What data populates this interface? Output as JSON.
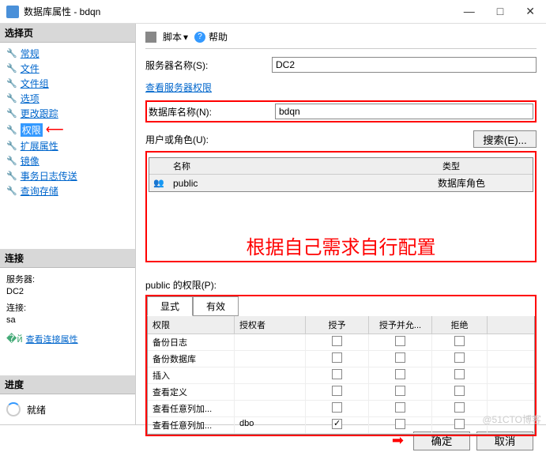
{
  "window": {
    "title": "数据库属性 - bdqn"
  },
  "sidebar": {
    "select_page_header": "选择页",
    "nav": [
      {
        "label": "常规"
      },
      {
        "label": "文件"
      },
      {
        "label": "文件组"
      },
      {
        "label": "选项"
      },
      {
        "label": "更改跟踪"
      },
      {
        "label": "权限",
        "selected": true
      },
      {
        "label": "扩展属性"
      },
      {
        "label": "镜像"
      },
      {
        "label": "事务日志传送"
      },
      {
        "label": "查询存储"
      }
    ],
    "connection_header": "连接",
    "connection": {
      "server_label": "服务器:",
      "server_value": "DC2",
      "conn_label": "连接:",
      "conn_value": "sa",
      "view_props": "查看连接属性"
    },
    "progress_header": "进度",
    "progress": {
      "status": "就绪"
    }
  },
  "toolbar": {
    "script": "脚本",
    "help": "帮助"
  },
  "form": {
    "server_name_label": "服务器名称(S):",
    "server_name_value": "DC2",
    "view_server_perms": "查看服务器权限",
    "db_name_label": "数据库名称(N):",
    "db_name_value": "bdqn",
    "user_role_label": "用户或角色(U):",
    "search_btn": "搜索(E)..."
  },
  "roles_table": {
    "col_name": "名称",
    "col_type": "类型",
    "rows": [
      {
        "name": "public",
        "type": "数据库角色"
      }
    ]
  },
  "annotation": "根据自己需求自行配置",
  "perms": {
    "label": "public 的权限(P):",
    "tab_explicit": "显式",
    "tab_effective": "有效",
    "columns": {
      "perm": "权限",
      "grantor": "授权者",
      "grant": "授予",
      "grant_with": "授予并允...",
      "deny": "拒绝"
    },
    "rows": [
      {
        "perm": "备份日志",
        "grantor": "",
        "grant": false,
        "grant_with": false,
        "deny": false
      },
      {
        "perm": "备份数据库",
        "grantor": "",
        "grant": false,
        "grant_with": false,
        "deny": false
      },
      {
        "perm": "插入",
        "grantor": "",
        "grant": false,
        "grant_with": false,
        "deny": false
      },
      {
        "perm": "查看定义",
        "grantor": "",
        "grant": false,
        "grant_with": false,
        "deny": false
      },
      {
        "perm": "查看任意列加...",
        "grantor": "",
        "grant": false,
        "grant_with": false,
        "deny": false
      },
      {
        "perm": "查看任意列加...",
        "grantor": "dbo",
        "grant": true,
        "grant_with": false,
        "deny": false
      }
    ]
  },
  "footer": {
    "ok": "确定",
    "cancel": "取消"
  },
  "watermark": "@51CTO博客"
}
